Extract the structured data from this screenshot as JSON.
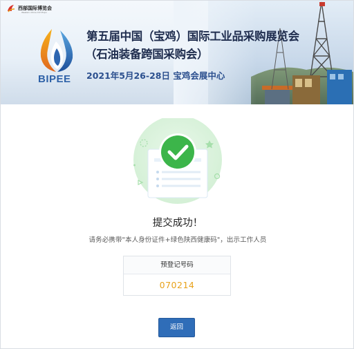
{
  "banner": {
    "top_logo_text": "西部国际博览会",
    "top_logo_subtext": "Western China Int'l Expo",
    "brand": "BIPEE",
    "title_line1": "第五届中国（宝鸡）国际工业品采购展览会",
    "title_line2": "（石油装备跨国采购会）",
    "date_venue": "2021年5月26-28日   宝鸡会展中心"
  },
  "result": {
    "title": "提交成功！",
    "notice": "请务必携带\"本人身份证件+绿色陕西健康码\"，出示工作人员"
  },
  "registration": {
    "label": "预登记号码",
    "code": "070214"
  },
  "actions": {
    "back_label": "返回"
  },
  "colors": {
    "accent": "#2f6db8",
    "success": "#3cb54a",
    "code": "#e8a21a"
  },
  "icons": {
    "success": "check-circle-icon"
  }
}
